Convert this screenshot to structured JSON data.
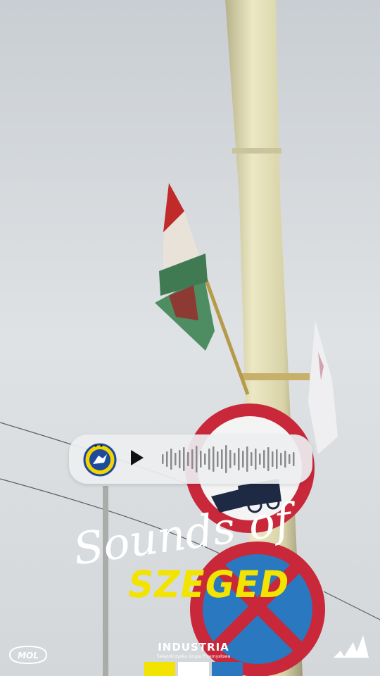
{
  "audio": {
    "club_logo_icon": "handball-club-crest-icon",
    "play_icon": "play-icon",
    "waveform_icon": "audio-waveform-icon"
  },
  "title": {
    "script_line": "Sounds of",
    "city_line": "SZEGED"
  },
  "sponsors": {
    "left_logo": "MOL",
    "center_name": "INDUSTRIA",
    "center_subtitle": "Świętokrzyska Grupa Przemysłowa",
    "right_logo_icon": "adidas-icon"
  },
  "colors": {
    "accent_yellow": "#f2e400",
    "sign_red": "#c8283a",
    "sign_blue": "#2a78c0",
    "sky": "#d9dde0"
  }
}
